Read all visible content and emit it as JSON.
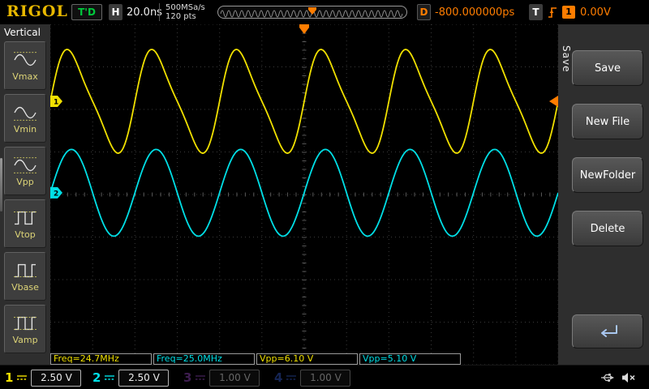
{
  "colors": {
    "ch1": "#f0e000",
    "ch2": "#00dfe6",
    "ch3": "#7a3b9e",
    "ch4": "#2b4ba8",
    "trigger": "#ff7d00",
    "logo": "#e8b800",
    "status_green": "#00c83c",
    "panel": "#2e2e2e",
    "screen_bg": "#000000"
  },
  "top_bar": {
    "logo": "RIGOL",
    "trigger_status": "T'D",
    "horizontal_label": "H",
    "timebase": "20.0ns",
    "sample_rate": "500MSa/s",
    "memory_depth": "120 pts",
    "delay_label": "D",
    "delay_value": "-800.000000ps",
    "trigger_label": "T",
    "trigger_source": "1",
    "trigger_level": "0.00V"
  },
  "left_menu": {
    "title": "Vertical",
    "items": [
      {
        "id": "vmax",
        "label": "Vmax"
      },
      {
        "id": "vmin",
        "label": "Vmin"
      },
      {
        "id": "vpp",
        "label": "Vpp"
      },
      {
        "id": "vtop",
        "label": "Vtop"
      },
      {
        "id": "vbase",
        "label": "Vbase"
      },
      {
        "id": "vamp",
        "label": "Vamp"
      }
    ]
  },
  "right_menu": {
    "tab": "Save",
    "buttons": [
      {
        "id": "save",
        "label": "Save"
      },
      {
        "id": "new-file",
        "label": "New File"
      },
      {
        "id": "new-folder",
        "label": "NewFolder"
      },
      {
        "id": "delete",
        "label": "Delete"
      }
    ]
  },
  "measurements": [
    {
      "label": "Freq=24.7MHz",
      "channel": "ch1"
    },
    {
      "label": "Freq=25.0MHz",
      "channel": "ch2"
    },
    {
      "label": "Vpp=6.10 V",
      "channel": "ch1"
    },
    {
      "label": "Vpp=5.10 V",
      "channel": "ch2"
    }
  ],
  "channel_bar": [
    {
      "num": "1",
      "scale": "2.50 V",
      "active": true,
      "color_ref": "ch1"
    },
    {
      "num": "2",
      "scale": "2.50 V",
      "active": true,
      "color_ref": "ch2"
    },
    {
      "num": "3",
      "scale": "1.00 V",
      "active": false,
      "color_ref": "ch3"
    },
    {
      "num": "4",
      "scale": "1.00 V",
      "active": false,
      "color_ref": "ch4"
    }
  ],
  "graticule": {
    "x_divisions": 12,
    "y_divisions": 8
  },
  "chart_data": {
    "type": "line",
    "title": "Oscilloscope waveform display",
    "x_axis": {
      "seconds_per_division": "20.0ns",
      "divisions": 12
    },
    "y_axis": {
      "divisions": 8
    },
    "trigger": {
      "level_volts": 0.0,
      "level_div_from_top": 1.81,
      "position_div_from_left": 6
    },
    "series": [
      {
        "name": "CH1",
        "channel": "1",
        "color_ref": "ch1",
        "shape": "distorted-sine",
        "harmonic2": 0.2,
        "volts_per_div": 2.5,
        "vpp_volts": 6.1,
        "frequency_mhz": 24.7,
        "period_divisions": 2,
        "center_div_from_top": 1.81,
        "rising_zero_div": 6
      },
      {
        "name": "CH2",
        "channel": "2",
        "color_ref": "ch2",
        "shape": "sine",
        "harmonic2": 0,
        "volts_per_div": 2.5,
        "vpp_volts": 5.1,
        "frequency_mhz": 25.0,
        "period_divisions": 2,
        "center_div_from_top": 3.96,
        "rising_zero_div": 6
      }
    ]
  }
}
